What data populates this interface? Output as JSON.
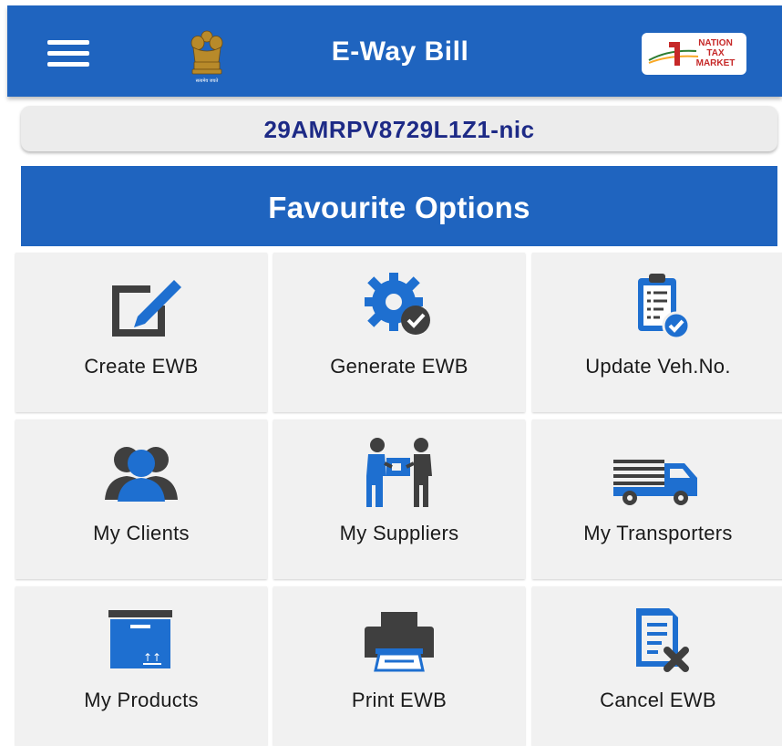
{
  "header": {
    "title": "E-Way Bill",
    "emblem_caption": "सत्यमेव जयते",
    "partner_logo_lines": [
      "NATION",
      "TAX",
      "MARKET"
    ]
  },
  "user": {
    "gstin": "29AMRPV8729L1Z1-nic"
  },
  "favourites": {
    "title": "Favourite Options",
    "items": [
      {
        "label": "Create EWB",
        "icon": "edit-icon"
      },
      {
        "label": "Generate EWB",
        "icon": "gear-check-icon"
      },
      {
        "label": "Update Veh.No.",
        "icon": "clipboard-check-icon"
      },
      {
        "label": "My Clients",
        "icon": "users-icon"
      },
      {
        "label": "My Suppliers",
        "icon": "handover-icon"
      },
      {
        "label": "My Transporters",
        "icon": "truck-icon"
      },
      {
        "label": "My Products",
        "icon": "box-icon"
      },
      {
        "label": "Print EWB",
        "icon": "printer-icon"
      },
      {
        "label": "Cancel EWB",
        "icon": "document-cancel-icon"
      }
    ]
  },
  "colors": {
    "primary": "#1f64bf",
    "icon_blue": "#1e6fd0",
    "icon_dark": "#3f3f3f",
    "gstin_text": "#1d2a86",
    "tile_bg": "#f1f1f1"
  }
}
